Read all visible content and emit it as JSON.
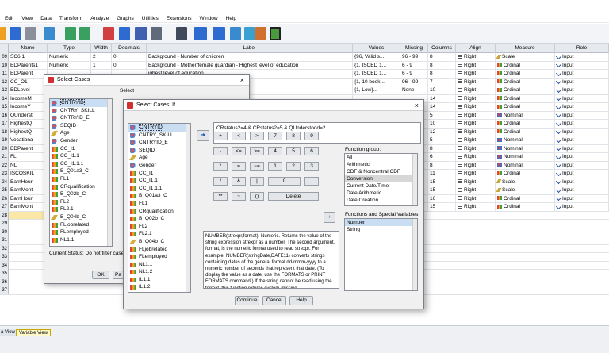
{
  "menu": [
    "Edit",
    "View",
    "Data",
    "Transform",
    "Analyze",
    "Graphs",
    "Utilities",
    "Extensions",
    "Window",
    "Help"
  ],
  "columns": [
    "Name",
    "Type",
    "Width",
    "Decimals",
    "Label",
    "Values",
    "Missing",
    "Columns",
    "Align",
    "Measure",
    "Role"
  ],
  "rows": [
    {
      "n": "09",
      "name": "SC6.1",
      "type": "Numeric",
      "width": "2",
      "dec": "0",
      "label": "Background - Number of children",
      "values": "{96, Valid s...",
      "missing": "96 - 99",
      "cols": "8",
      "align": "Right",
      "measure": "Scale",
      "mclass": "scale",
      "role": "Input"
    },
    {
      "n": "10",
      "name": "EDParents1",
      "type": "Numeric",
      "width": "1",
      "dec": "0",
      "label": "Background - Mother/female guardian - Highest level of education",
      "values": "{1, ISCED 1...",
      "missing": "6 - 9",
      "cols": "8",
      "align": "Right",
      "measure": "Ordinal",
      "mclass": "ordinal",
      "role": "Input"
    },
    {
      "n": "11",
      "name": "EDParent",
      "type": "",
      "width": "",
      "dec": "",
      "label": "ighest level of education",
      "values": "{1, ISCED 1...",
      "missing": "6 - 9",
      "cols": "8",
      "align": "Right",
      "measure": "Ordinal",
      "mclass": "ordinal",
      "role": "Input"
    },
    {
      "n": "12",
      "name": "CC_O1",
      "type": "",
      "width": "",
      "dec": "",
      "label": "",
      "values": "{1, 10 book...",
      "missing": "96 - 99",
      "cols": "7",
      "align": "Right",
      "measure": "Ordinal",
      "mclass": "ordinal",
      "role": "Input"
    },
    {
      "n": "13",
      "name": "EDLevel",
      "type": "",
      "width": "",
      "dec": "",
      "label": "SIVED BY CAPI)",
      "values": "{1, Low}...",
      "missing": "None",
      "cols": "10",
      "align": "Right",
      "measure": "Ordinal",
      "mclass": "ordinal",
      "role": "Input"
    },
    {
      "n": "14",
      "name": "IncomeM",
      "type": "",
      "width": "",
      "dec": "",
      "label": "",
      "values": "",
      "missing": "",
      "cols": "14",
      "align": "Right",
      "measure": "Ordinal",
      "mclass": "ordinal",
      "role": "Input"
    },
    {
      "n": "15",
      "name": "IncomeY",
      "type": "",
      "width": "",
      "dec": "",
      "label": "",
      "values": "",
      "missing": "",
      "cols": "14",
      "align": "Right",
      "measure": "Ordinal",
      "mclass": "ordinal",
      "role": "Input"
    },
    {
      "n": "16",
      "name": "QUndersti",
      "type": "",
      "width": "",
      "dec": "",
      "label": "",
      "values": "",
      "missing": "",
      "cols": "5",
      "align": "Right",
      "measure": "Nominal",
      "mclass": "nominal",
      "role": "Input"
    },
    {
      "n": "17",
      "name": "HighestQ",
      "type": "",
      "width": "",
      "dec": "",
      "label": "",
      "values": "",
      "missing": "",
      "cols": "10",
      "align": "Right",
      "measure": "Ordinal",
      "mclass": "ordinal",
      "role": "Input"
    },
    {
      "n": "18",
      "name": "HighestQ",
      "type": "",
      "width": "",
      "dec": "",
      "label": "",
      "values": "",
      "missing": "",
      "cols": "12",
      "align": "Right",
      "measure": "Ordinal",
      "mclass": "ordinal",
      "role": "Input"
    },
    {
      "n": "19",
      "name": "Vocationa",
      "type": "",
      "width": "",
      "dec": "",
      "label": "",
      "values": "",
      "missing": "",
      "cols": "5",
      "align": "Right",
      "measure": "Nominal",
      "mclass": "nominal",
      "role": "Input"
    },
    {
      "n": "20",
      "name": "EDParent",
      "type": "",
      "width": "",
      "dec": "",
      "label": "",
      "values": "",
      "missing": "",
      "cols": "8",
      "align": "Right",
      "measure": "Nominal",
      "mclass": "nominal",
      "role": "Input"
    },
    {
      "n": "21",
      "name": "FL",
      "type": "",
      "width": "",
      "dec": "",
      "label": "",
      "values": "",
      "missing": "",
      "cols": "6",
      "align": "Right",
      "measure": "Nominal",
      "mclass": "nominal",
      "role": "Input"
    },
    {
      "n": "22",
      "name": "NL",
      "type": "",
      "width": "",
      "dec": "",
      "label": "",
      "values": "",
      "missing": "",
      "cols": "8",
      "align": "Right",
      "measure": "Nominal",
      "mclass": "nominal",
      "role": "Input"
    },
    {
      "n": "23",
      "name": "ISCOSKIL",
      "type": "",
      "width": "",
      "dec": "",
      "label": "",
      "values": "",
      "missing": "",
      "cols": "11",
      "align": "Right",
      "measure": "Ordinal",
      "mclass": "ordinal",
      "role": "Input"
    },
    {
      "n": "24",
      "name": "EarnHour",
      "type": "",
      "width": "",
      "dec": "",
      "label": "",
      "values": "",
      "missing": "",
      "cols": "15",
      "align": "Right",
      "measure": "Scale",
      "mclass": "scale",
      "role": "Input"
    },
    {
      "n": "25",
      "name": "EarnMont",
      "type": "",
      "width": "",
      "dec": "",
      "label": "",
      "values": "",
      "missing": "",
      "cols": "15",
      "align": "Right",
      "measure": "Scale",
      "mclass": "scale",
      "role": "Input"
    },
    {
      "n": "26",
      "name": "EarnHour",
      "type": "",
      "width": "",
      "dec": "",
      "label": "",
      "values": "",
      "missing": "",
      "cols": "16",
      "align": "Right",
      "measure": "Ordinal",
      "mclass": "ordinal",
      "role": "Input"
    },
    {
      "n": "27",
      "name": "EarnMont",
      "type": "",
      "width": "",
      "dec": "",
      "label": "",
      "values": "",
      "missing": "",
      "cols": "15",
      "align": "Right",
      "measure": "Ordinal",
      "mclass": "ordinal",
      "role": "Input"
    }
  ],
  "empty_rows": [
    "28",
    "29",
    "30",
    "31",
    "32",
    "33",
    "34",
    "35",
    "36",
    "37"
  ],
  "tabs": {
    "data": "a View",
    "variable": "Variable View"
  },
  "dialog_outer": {
    "title": "Select Cases",
    "select_label": "Select",
    "vars": [
      "CNTRYID",
      "CNTRY_SKILL",
      "CNTRYID_E",
      "SEQID",
      "Age",
      "Gender",
      "CC_I1",
      "CC_I1.1",
      "CC_I1.1.1",
      "B_Q01a3_C",
      "FL1",
      "CRqualification",
      "B_Q02b_C",
      "FL2",
      "FL2.1",
      "B_Q04b_C",
      "FLjobrelated",
      "FLemployed",
      "NL1.1"
    ],
    "var_icons": [
      "nom",
      "nom",
      "nom",
      "nom",
      "sca",
      "nom",
      "ord",
      "ord",
      "ord",
      "ord",
      "ord",
      "ord",
      "ord",
      "ord",
      "ord",
      "sca",
      "ord",
      "ord",
      "ord"
    ],
    "status": "Current Status: Do not filter case",
    "ok": "OK",
    "paste": "Pa"
  },
  "dialog_if": {
    "title": "Select Cases: If",
    "vars": [
      "CNTRYID",
      "CNTRY_SKILL",
      "CNTRYID_E",
      "SEQID",
      "Age",
      "Gender",
      "CC_I1",
      "CC_I1.1",
      "CC_I1.1.1",
      "B_Q01a3_C",
      "FL1",
      "CRqualification",
      "B_Q02b_C",
      "FL2",
      "FL2.1",
      "B_Q04b_C",
      "FLjobrelated",
      "FLemployed",
      "NL1.1",
      "NL1.2",
      "IL1.1",
      "IL1.2"
    ],
    "var_icons": [
      "nom",
      "nom",
      "nom",
      "nom",
      "sca",
      "nom",
      "ord",
      "ord",
      "ord",
      "ord",
      "ord",
      "ord",
      "ord",
      "ord",
      "ord",
      "sca",
      "ord",
      "ord",
      "ord",
      "ord",
      "ord",
      "ord"
    ],
    "expression": "CRstatus2=4 & CRstatus2=5 & QUnderstood=2",
    "keypad": [
      [
        "+",
        "<",
        ">",
        "7",
        "8",
        "9"
      ],
      [
        "-",
        "<=",
        ">=",
        "4",
        "5",
        "6"
      ],
      [
        "*",
        "=",
        "~=",
        "1",
        "2",
        "3"
      ],
      [
        "/",
        "&",
        "|",
        "0",
        "."
      ],
      [
        "**",
        "~",
        "()",
        "Delete"
      ]
    ],
    "function_group_label": "Function group:",
    "function_groups": [
      "All",
      "Arithmetic",
      "CDF & Noncentral CDF",
      "Conversion",
      "Current Date/Time",
      "Date Arithmetic",
      "Date Creation"
    ],
    "selected_group": "Conversion",
    "functions_label": "Functions and Special Variables:",
    "functions": [
      "Number",
      "String"
    ],
    "description": "NUMBER(strexpr,format). Numeric. Returns the value of the string expression strexpr as a number. The second argument, format, is the numeric format used to read strexpr. For example, NUMBER(stringDate,DATE11) converts strings containing dates of the general format dd-mmm-yyyy to a numeric number of seconds that represent that date. (To display the value as a date, use the FORMATS or PRINT FORMATS command.) If the string cannot be read using the format, this function returns system-missing.",
    "buttons": {
      "continue": "Continue",
      "cancel": "Cancel",
      "help": "Help"
    }
  }
}
